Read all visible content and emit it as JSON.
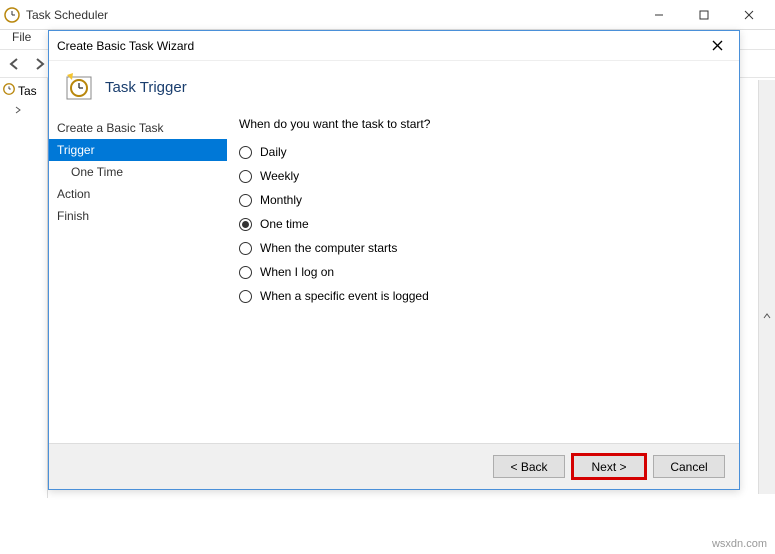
{
  "app": {
    "title": "Task Scheduler",
    "menu_file": "File",
    "tree_root": "Tas"
  },
  "dialog": {
    "window_title": "Create Basic Task Wizard",
    "page_title": "Task Trigger",
    "nav": {
      "create": "Create a Basic Task",
      "trigger": "Trigger",
      "one_time": "One Time",
      "action": "Action",
      "finish": "Finish"
    },
    "question": "When do you want the task to start?",
    "options": {
      "daily": "Daily",
      "weekly": "Weekly",
      "monthly": "Monthly",
      "one_time": "One time",
      "computer_starts": "When the computer starts",
      "log_on": "When I log on",
      "specific_event": "When a specific event is logged"
    },
    "buttons": {
      "back": "< Back",
      "next": "Next >",
      "cancel": "Cancel"
    }
  },
  "watermark": "wsxdn.com"
}
